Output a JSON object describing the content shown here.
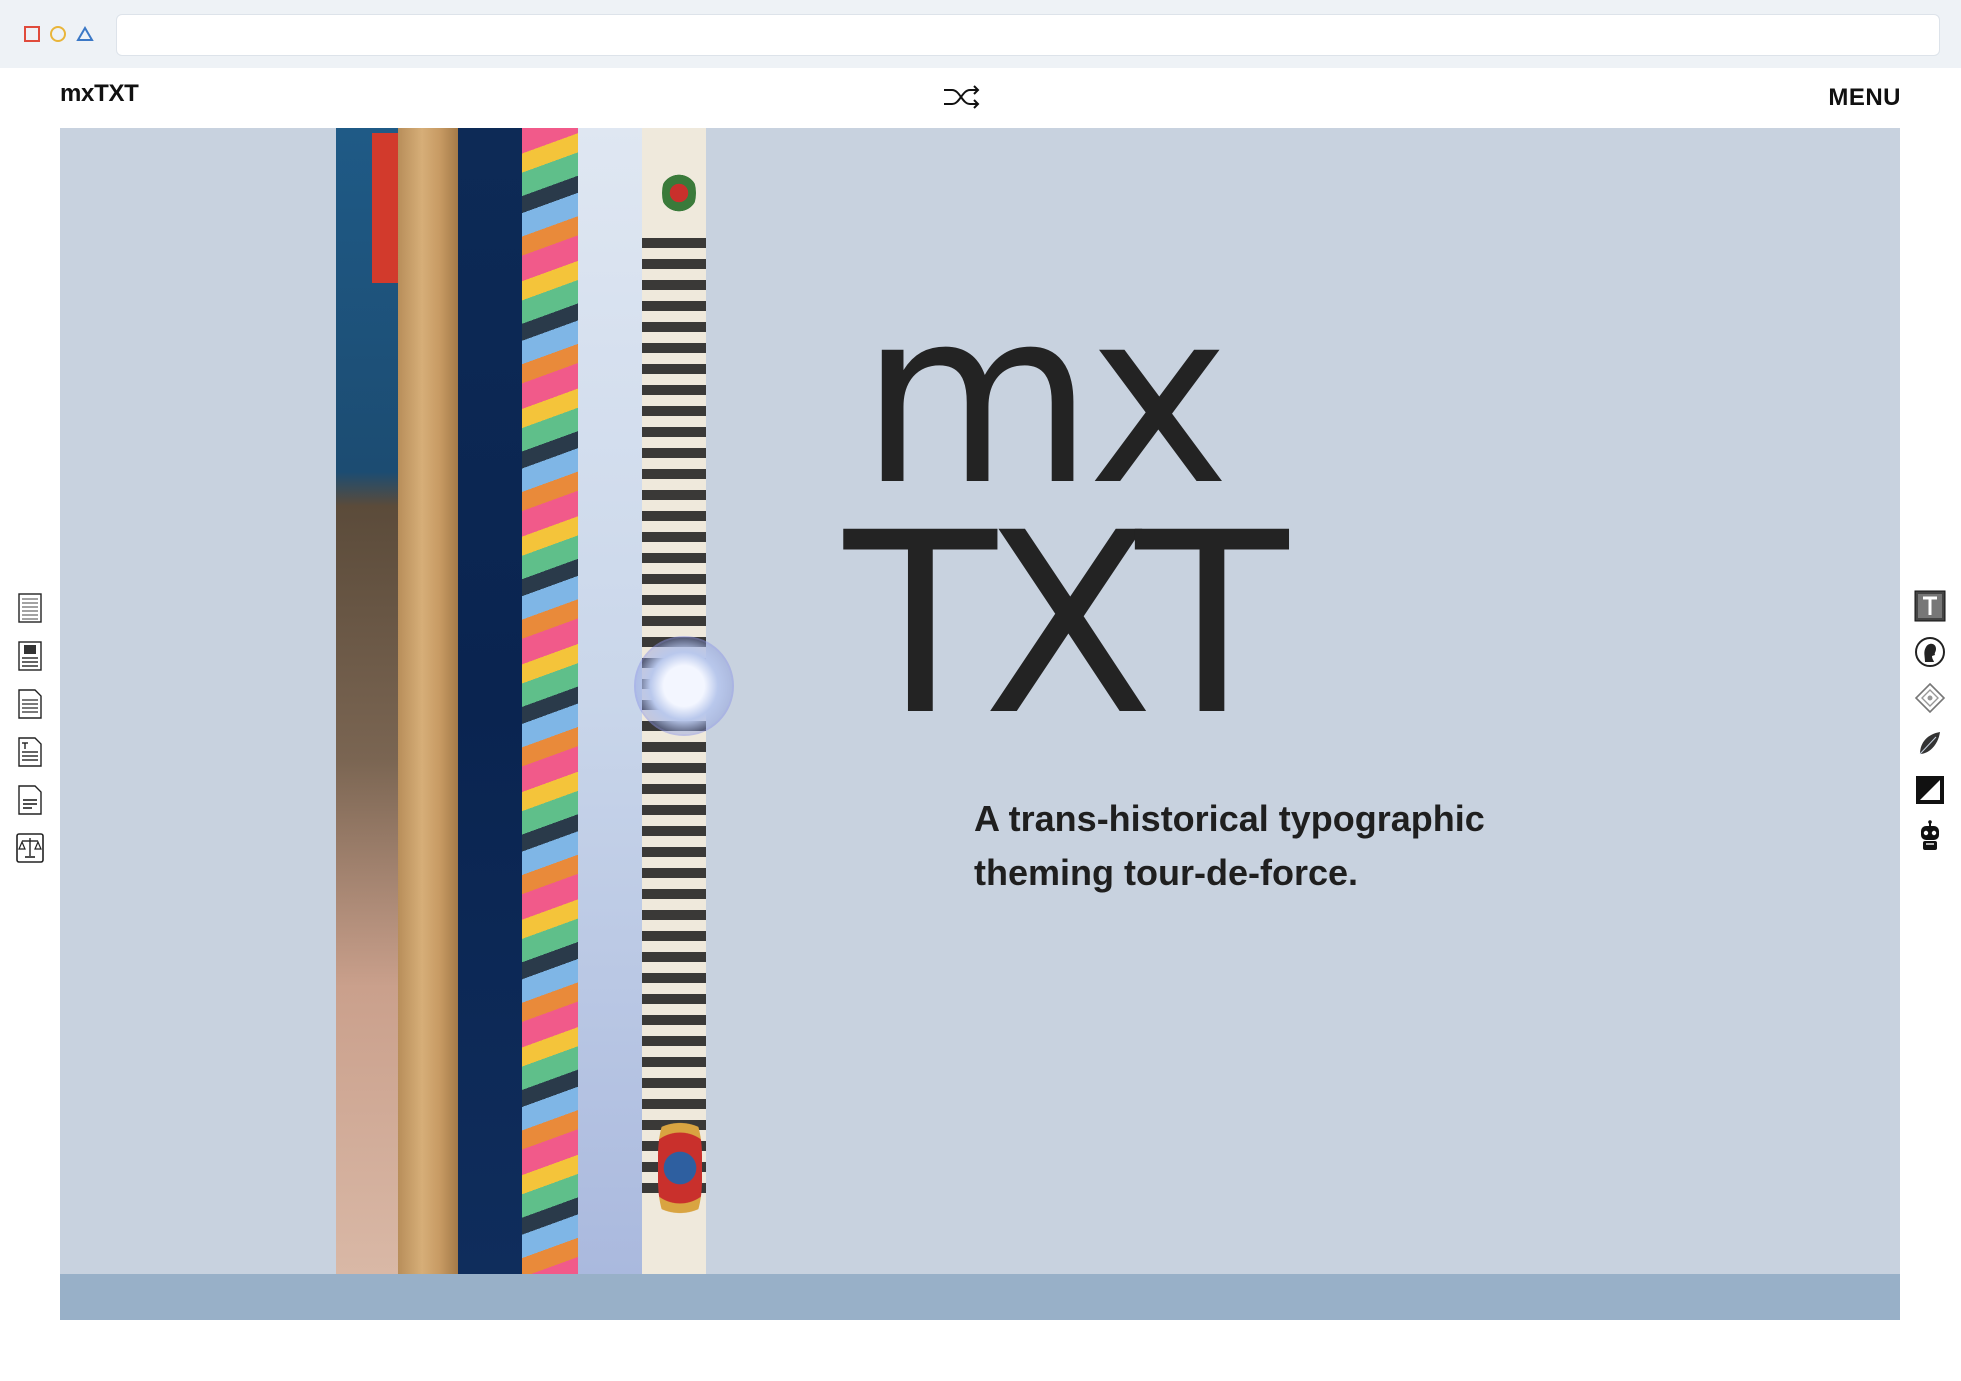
{
  "header": {
    "logo": "mxTXT",
    "menu_label": "MENU",
    "shuffle_icon": "shuffle-icon"
  },
  "hero": {
    "title_line1": "mx",
    "title_line2": "TXT",
    "tagline": "A trans-historical typographic theming tour-de-force."
  },
  "left_toolbar": [
    {
      "icon": "lined-page-icon"
    },
    {
      "icon": "illustrated-page-icon"
    },
    {
      "icon": "document-icon"
    },
    {
      "icon": "titled-document-icon"
    },
    {
      "icon": "short-text-page-icon"
    },
    {
      "icon": "scales-document-icon"
    }
  ],
  "right_toolbar": [
    {
      "icon": "ornate-letter-icon"
    },
    {
      "icon": "silhouette-portrait-icon"
    },
    {
      "icon": "diamond-ornament-icon"
    },
    {
      "icon": "feather-icon"
    },
    {
      "icon": "contrast-icon"
    },
    {
      "icon": "robot-icon"
    }
  ],
  "colors": {
    "hero_bg": "#c8d2df",
    "footer_bar": "#98b0c8",
    "text": "#232323"
  }
}
